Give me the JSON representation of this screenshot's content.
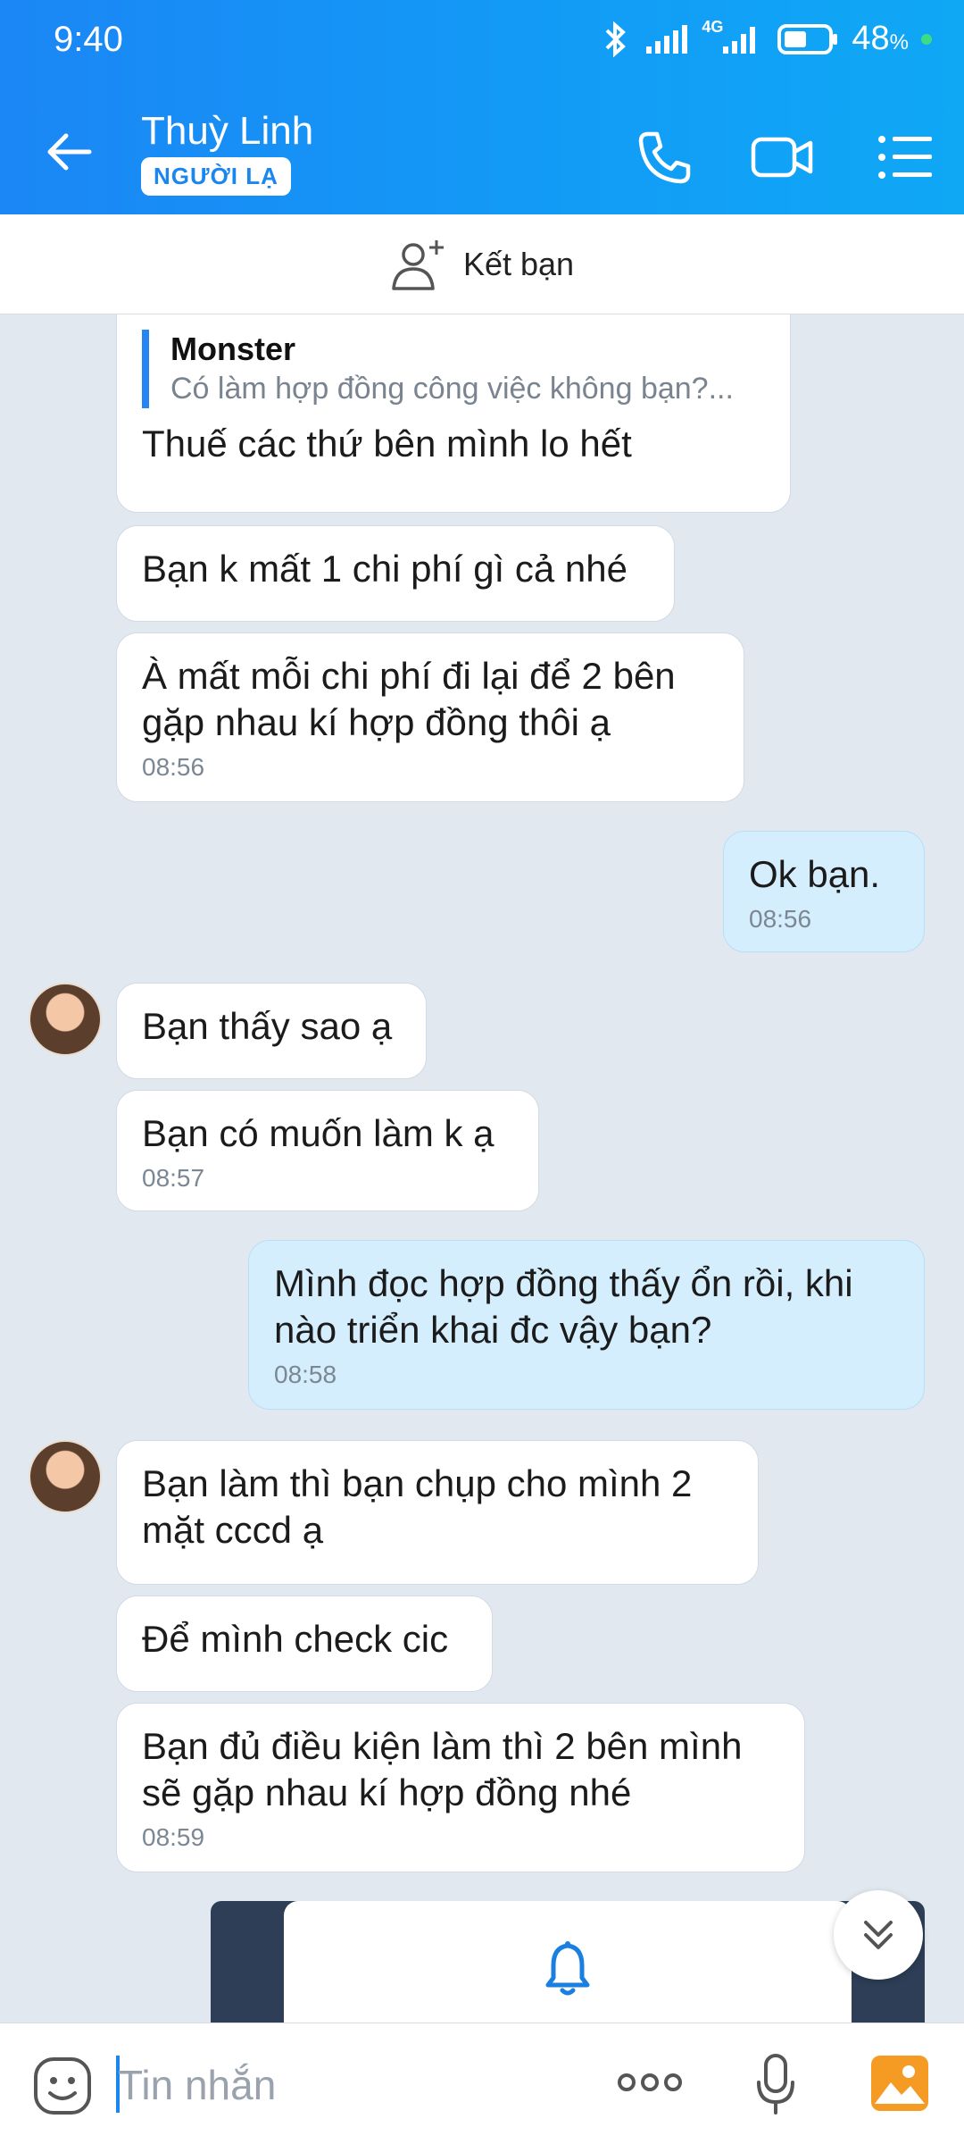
{
  "status": {
    "time": "9:40",
    "battery": "48",
    "battery_unit": "%",
    "network": "4G"
  },
  "header": {
    "name": "Thuỳ Linh",
    "badge": "NGƯỜI LẠ"
  },
  "friend_bar": {
    "label": "Kết bạn"
  },
  "messages": [
    {
      "quote_name": "Monster",
      "quote_text": "Có làm hợp đồng công việc không bạn?...",
      "text": "Thuế các thứ bên mình lo hết"
    },
    {
      "text": "Bạn k mất 1 chi phí gì cả nhé"
    },
    {
      "text": "À mất mỗi chi phí đi lại để 2 bên gặp nhau kí hợp đồng thôi ạ",
      "time": "08:56"
    },
    {
      "text": "Ok bạn.",
      "time": "08:56"
    },
    {
      "text": "Bạn thấy sao ạ"
    },
    {
      "text": "Bạn có muốn làm k ạ",
      "time": "08:57"
    },
    {
      "text": "Mình đọc hợp đồng thấy ổn rồi, khi nào triển khai đc vậy bạn?",
      "time": "08:58"
    },
    {
      "text": "Bạn làm thì bạn chụp cho mình 2 mặt cccd ạ"
    },
    {
      "text": "Để mình check cic"
    },
    {
      "text": "Bạn đủ điều kiện làm thì 2 bên mình sẽ gặp nhau kí hợp đồng nhé",
      "time": "08:59"
    }
  ],
  "input": {
    "placeholder": "Tin nhắn"
  },
  "icons": {
    "back": "arrow-left-icon",
    "call": "phone-icon",
    "video": "video-camera-icon",
    "menu": "list-menu-icon",
    "add_friend": "add-person-icon",
    "bell": "bell-icon",
    "scroll": "chevron-double-down-icon",
    "sticker": "smiley-icon",
    "more": "more-dots-icon",
    "mic": "microphone-icon",
    "gallery": "image-icon"
  },
  "colors": {
    "header": "#1b86f5",
    "accent": "#1a86f0",
    "my_bubble": "#d5eefe",
    "other_bubble": "#ffffff",
    "background": "#e2e8f0"
  }
}
